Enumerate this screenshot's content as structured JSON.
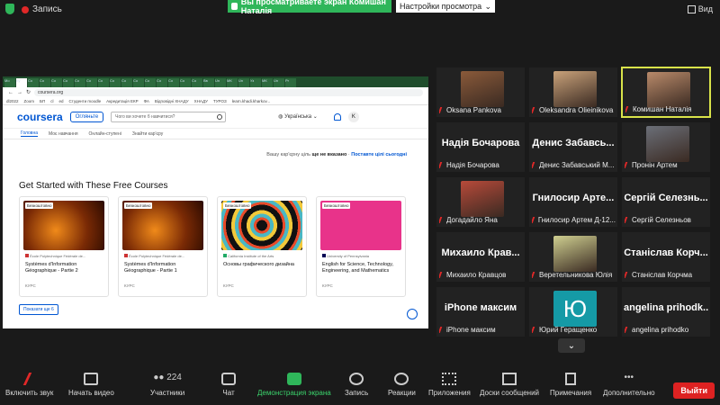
{
  "top": {
    "recording": "Запись",
    "share_banner": "Вы просматриваете экран Комишан Наталія",
    "view_options": "Настройки просмотра",
    "view": "Вид"
  },
  "browser": {
    "tabs": [
      "Мо",
      "Ку",
      "Co",
      "Co",
      "Co",
      "Co",
      "Co",
      "Co",
      "Co",
      "Co",
      "Co",
      "Co",
      "Co",
      "Co",
      "Co",
      "Co",
      "Co",
      "Вв",
      "Un",
      "МК",
      "Un",
      "Уз",
      "МК",
      "Un",
      "Рг"
    ],
    "url": "coursera.org",
    "bookmarks": [
      "dl2022",
      "Zoom",
      "БП",
      "cl",
      "ed",
      "Студенти moodle",
      "Акредитація ЕКР",
      "ФА",
      "Відповідні ХНАДУ",
      "ХНАДУ",
      "ТУРОЗ",
      "learn.khadi.kharkov..."
    ]
  },
  "coursera": {
    "logo": "coursera",
    "explore": "Огляньте",
    "search_placeholder": "Чого ви хочете б навчитися?",
    "language": "Українська",
    "avatar": "K",
    "nav": [
      "Головна",
      "Моє навчання",
      "Онлайн-ступені",
      "Знайти кар'єру"
    ],
    "goal_text": "Вашу кар'єрну ціль",
    "goal_bold": "ще не вказано",
    "goal_link": "Поставте цілі сьогодні",
    "section_title": "Get Started with These Free Courses",
    "free_badge": "Безкоштовно",
    "kind": "КУРС",
    "show_more": "Показати ще 6",
    "courses": [
      {
        "institution": "École Polytechnique Fédérale de...",
        "title": "Systèmes d'Information Géographique - Partie 2"
      },
      {
        "institution": "École Polytechnique Fédérale de...",
        "title": "Systèmes d'Information Géographique - Partie 1"
      },
      {
        "institution": "California Institute of the Arts",
        "title": "Основы графического дизайна"
      },
      {
        "institution": "University of Pennsylvania",
        "title": "English for Science, Technology, Engineering, and Mathematics"
      }
    ]
  },
  "participants": [
    {
      "name": "Oksana Pankova",
      "big": "",
      "photo": true
    },
    {
      "name": "Oleksandra Olieinikova",
      "big": "",
      "photo": true
    },
    {
      "name": "Комишан Наталія",
      "big": "",
      "photo": true,
      "active": true
    },
    {
      "name": "Надія Бочарова",
      "big": "Надія Бочарова",
      "photo": false
    },
    {
      "name": "Денис Забавський М...",
      "big": "Денис Забавсь...",
      "photo": false
    },
    {
      "name": "Пронін Артем",
      "big": "",
      "photo": true
    },
    {
      "name": "Догадайло Яна",
      "big": "",
      "photo": true
    },
    {
      "name": "Гнилосир Артем Д-12...",
      "big": "Гнилосир Арте...",
      "photo": false
    },
    {
      "name": "Сергій Селезньов",
      "big": "Сергій Селезнь...",
      "photo": false
    },
    {
      "name": "Михаило Кравцов",
      "big": "Михаило Крав...",
      "photo": false
    },
    {
      "name": "Веретельникова Юлія",
      "big": "",
      "photo": true
    },
    {
      "name": "Станіслав Корчма",
      "big": "Станіслав Корч...",
      "photo": false
    },
    {
      "name": "iPhone максим",
      "big": "iPhone максим",
      "photo": false
    },
    {
      "name": "Юрий Геращенко",
      "big": "Ю",
      "photo": false,
      "teal": true
    },
    {
      "name": "angelina prihodko",
      "big": "angelina prihodk...",
      "photo": false
    }
  ],
  "toolbar": {
    "mute": "Включить звук",
    "video": "Начать видео",
    "participants": "Участники",
    "participants_count": "224",
    "chat": "Чат",
    "share": "Демонстрация экрана",
    "record": "Запись",
    "reactions": "Реакции",
    "apps": "Приложения",
    "whiteboard": "Доски сообщений",
    "notes": "Примечания",
    "more": "Дополнительно",
    "leave": "Выйти"
  },
  "colors": {
    "accent_green": "#2fb65a",
    "coursera_blue": "#0056d2",
    "leave_red": "#dd2222",
    "active_border": "#d9e34a"
  }
}
